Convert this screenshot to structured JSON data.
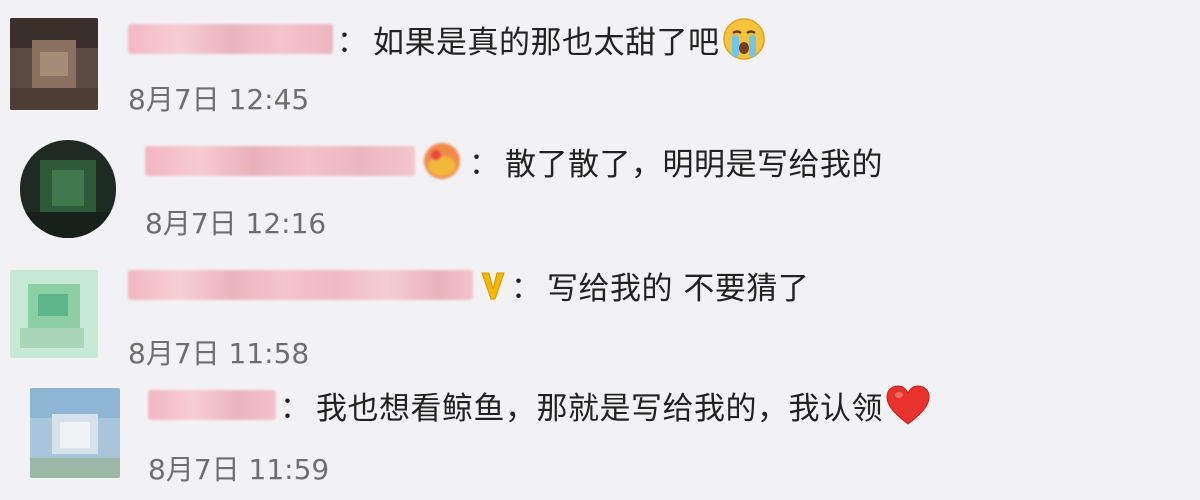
{
  "comments": [
    {
      "message": "如果是真的那也太甜了吧",
      "time": "8月7日 12:45",
      "emoji": "crying-face-icon"
    },
    {
      "message": "散了散了，明明是写给我的",
      "time": "8月7日 12:16",
      "badge": "fire-badge-icon"
    },
    {
      "message": "写给我的 不要猜了",
      "time": "8月7日 11:58",
      "badge": "vip-v-badge-icon"
    },
    {
      "message": "我也想看鲸鱼，那就是写给我的，我认领",
      "time": "8月7日 11:59",
      "emoji": "red-heart-icon"
    }
  ],
  "colors": {
    "background": "#f2f2f4",
    "text": "#222222",
    "time": "#6e6e6e",
    "blur_pink": "#f2a7b6"
  }
}
